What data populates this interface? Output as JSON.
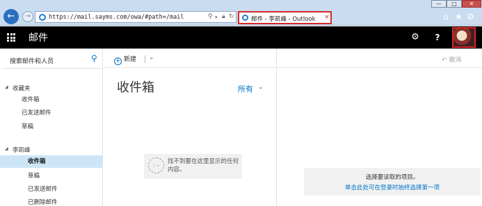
{
  "window": {
    "minimize": "—",
    "maximize": "□",
    "close": "✕"
  },
  "browser": {
    "back": "←",
    "forward": "→",
    "url": "https://mail.sayms.com/owa/#path=/mail",
    "tab_title": "邮件 - 李凯峰 - Outlook",
    "tab_close": "×",
    "icons": [
      "home-icon",
      "star-icon",
      "gear-icon"
    ]
  },
  "header": {
    "title": "邮件",
    "settings": "⚙",
    "help": "?"
  },
  "sidebar": {
    "search_label": "搜索邮件和人员",
    "favorites": {
      "label": "收藏夹",
      "items": [
        {
          "label": "收件箱"
        },
        {
          "label": "已发送邮件"
        },
        {
          "label": "草稿"
        }
      ]
    },
    "account": {
      "label": "李凯峰",
      "items": [
        {
          "label": "收件箱",
          "active": true
        },
        {
          "label": "草稿"
        },
        {
          "label": "已发送邮件"
        },
        {
          "label": "已删除邮件"
        }
      ]
    }
  },
  "list": {
    "new_label": "新建",
    "folder_title": "收件箱",
    "filter_label": "所有",
    "empty_text": "找不到要在这里显示的任何内容。"
  },
  "reading": {
    "undo_label": "撤消",
    "hint": "选择要读取的项目。",
    "link": "单击此处可在登录时始终选择第一项"
  },
  "colors": {
    "accent": "#0072c6",
    "header_bg": "#000000",
    "selected_bg": "#cde6f7",
    "tab_highlight": "#d62828"
  }
}
